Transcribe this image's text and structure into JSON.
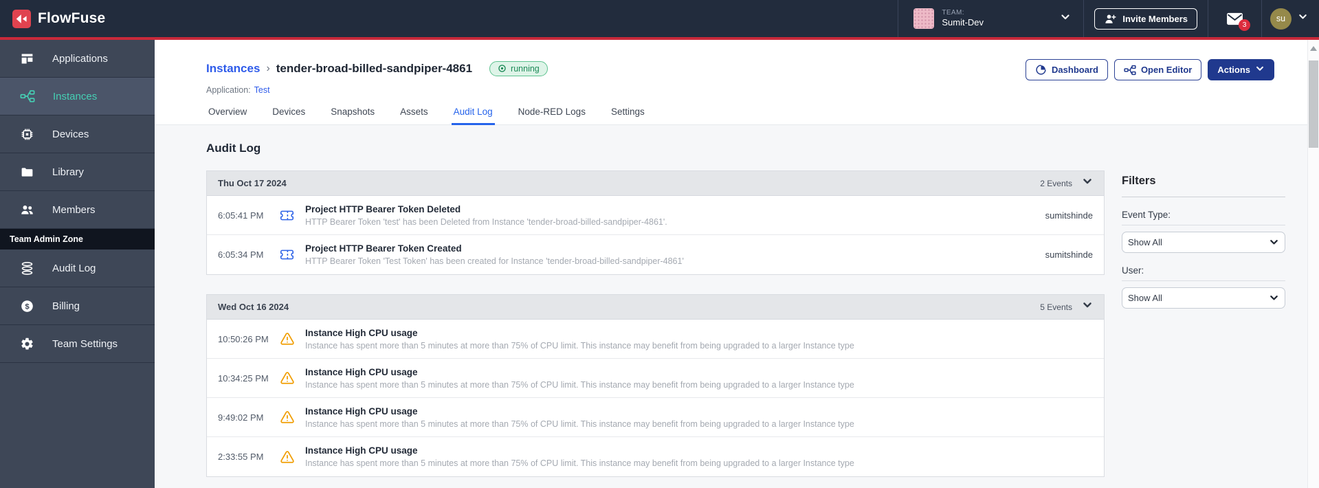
{
  "header": {
    "brand": "FlowFuse",
    "team_label": "TEAM:",
    "team_name": "Sumit-Dev",
    "invite_members_label": "Invite Members",
    "notification_badge": "3",
    "user_initials": "su"
  },
  "sidebar": {
    "items": [
      {
        "label": "Applications"
      },
      {
        "label": "Instances"
      },
      {
        "label": "Devices"
      },
      {
        "label": "Library"
      },
      {
        "label": "Members"
      }
    ],
    "admin_section_label": "Team Admin Zone",
    "admin_items": [
      {
        "label": "Audit Log"
      },
      {
        "label": "Billing"
      },
      {
        "label": "Team Settings"
      }
    ]
  },
  "breadcrumb": {
    "parent": "Instances",
    "separator": "›",
    "current": "tender-broad-billed-sandpiper-4861",
    "status_badge": "running",
    "application_label": "Application:",
    "application_link": "Test"
  },
  "toolbar": {
    "dashboard_label": "Dashboard",
    "open_editor_label": "Open Editor",
    "actions_label": "Actions"
  },
  "tabs": [
    {
      "label": "Overview"
    },
    {
      "label": "Devices"
    },
    {
      "label": "Snapshots"
    },
    {
      "label": "Assets"
    },
    {
      "label": "Audit Log"
    },
    {
      "label": "Node-RED Logs"
    },
    {
      "label": "Settings"
    }
  ],
  "audit": {
    "title": "Audit Log",
    "groups": [
      {
        "date": "Thu Oct 17 2024",
        "count": "2 Events",
        "events": [
          {
            "time": "6:05:41 PM",
            "icon": "ticket-icon",
            "title": "Project HTTP Bearer Token Deleted",
            "description": "HTTP Bearer Token 'test' has been Deleted from Instance 'tender-broad-billed-sandpiper-4861'.",
            "user": "sumitshinde"
          },
          {
            "time": "6:05:34 PM",
            "icon": "ticket-icon",
            "title": "Project HTTP Bearer Token Created",
            "description": "HTTP Bearer Token 'Test Token' has been created for Instance 'tender-broad-billed-sandpiper-4861'",
            "user": "sumitshinde"
          }
        ]
      },
      {
        "date": "Wed Oct 16 2024",
        "count": "5 Events",
        "events": [
          {
            "time": "10:50:26 PM",
            "icon": "warning-icon",
            "title": "Instance High CPU usage",
            "description": "Instance has spent more than 5 minutes at more than 75% of CPU limit. This instance may benefit from being upgraded to a larger Instance type",
            "user": ""
          },
          {
            "time": "10:34:25 PM",
            "icon": "warning-icon",
            "title": "Instance High CPU usage",
            "description": "Instance has spent more than 5 minutes at more than 75% of CPU limit. This instance may benefit from being upgraded to a larger Instance type",
            "user": ""
          },
          {
            "time": "9:49:02 PM",
            "icon": "warning-icon",
            "title": "Instance High CPU usage",
            "description": "Instance has spent more than 5 minutes at more than 75% of CPU limit. This instance may benefit from being upgraded to a larger Instance type",
            "user": ""
          },
          {
            "time": "2:33:55 PM",
            "icon": "warning-icon",
            "title": "Instance High CPU usage",
            "description": "Instance has spent more than 5 minutes at more than 75% of CPU limit. This instance may benefit from being upgraded to a larger Instance type",
            "user": ""
          }
        ]
      }
    ]
  },
  "filters": {
    "title": "Filters",
    "event_type_label": "Event Type:",
    "event_type_value": "Show All",
    "user_label": "User:",
    "user_value": "Show All"
  },
  "colors": {
    "header_bg": "#222c3d",
    "brand_red": "#e0434f",
    "accent_red_line": "#c9293a",
    "sidebar_bg": "#3e4757",
    "active_teal": "#45d0b4",
    "link_blue": "#2e5bea",
    "tab_active_blue": "#2563eb",
    "button_blue": "#20398e",
    "status_green": "#1d8a57",
    "warning_amber": "#f09d00",
    "ticket_blue": "#2e63e7"
  }
}
